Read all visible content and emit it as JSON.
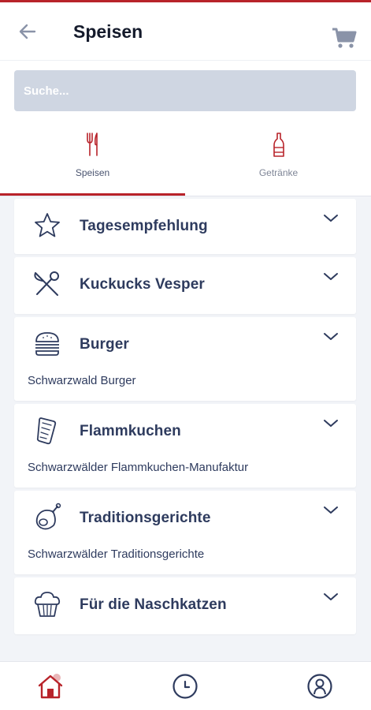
{
  "header": {
    "title": "Speisen",
    "back_icon": "arrow-left-icon",
    "cart_icon": "shopping-cart-icon"
  },
  "search": {
    "placeholder": "Suche...",
    "value": ""
  },
  "tabs": [
    {
      "label": "Speisen",
      "icon": "fork-knife-icon",
      "active": true
    },
    {
      "label": "Getränke",
      "icon": "bottle-icon",
      "active": false
    }
  ],
  "categories": [
    {
      "name": "Tagesempfehlung",
      "subtitle": "",
      "icon": "star-icon"
    },
    {
      "name": "Kuckucks Vesper",
      "subtitle": "",
      "icon": "knife-spoon-icon"
    },
    {
      "name": "Burger",
      "subtitle": "Schwarzwald Burger",
      "icon": "burger-icon"
    },
    {
      "name": "Flammkuchen",
      "subtitle": "Schwarzwälder Flammkuchen-Manufaktur",
      "icon": "flatbread-icon"
    },
    {
      "name": "Traditionsgerichte",
      "subtitle": "Schwarzwälder Traditionsgerichte",
      "icon": "ham-icon"
    },
    {
      "name": "Für die Naschkatzen",
      "subtitle": "",
      "icon": "cupcake-icon"
    }
  ],
  "bottom_nav": [
    {
      "icon": "home-icon",
      "active": true
    },
    {
      "icon": "clock-icon",
      "active": false
    },
    {
      "icon": "user-icon",
      "active": false
    }
  ],
  "colors": {
    "accent": "#b8232a",
    "text": "#2e3b5e",
    "search_bg": "#cfd6e2",
    "page_bg": "#f2f4f8"
  }
}
